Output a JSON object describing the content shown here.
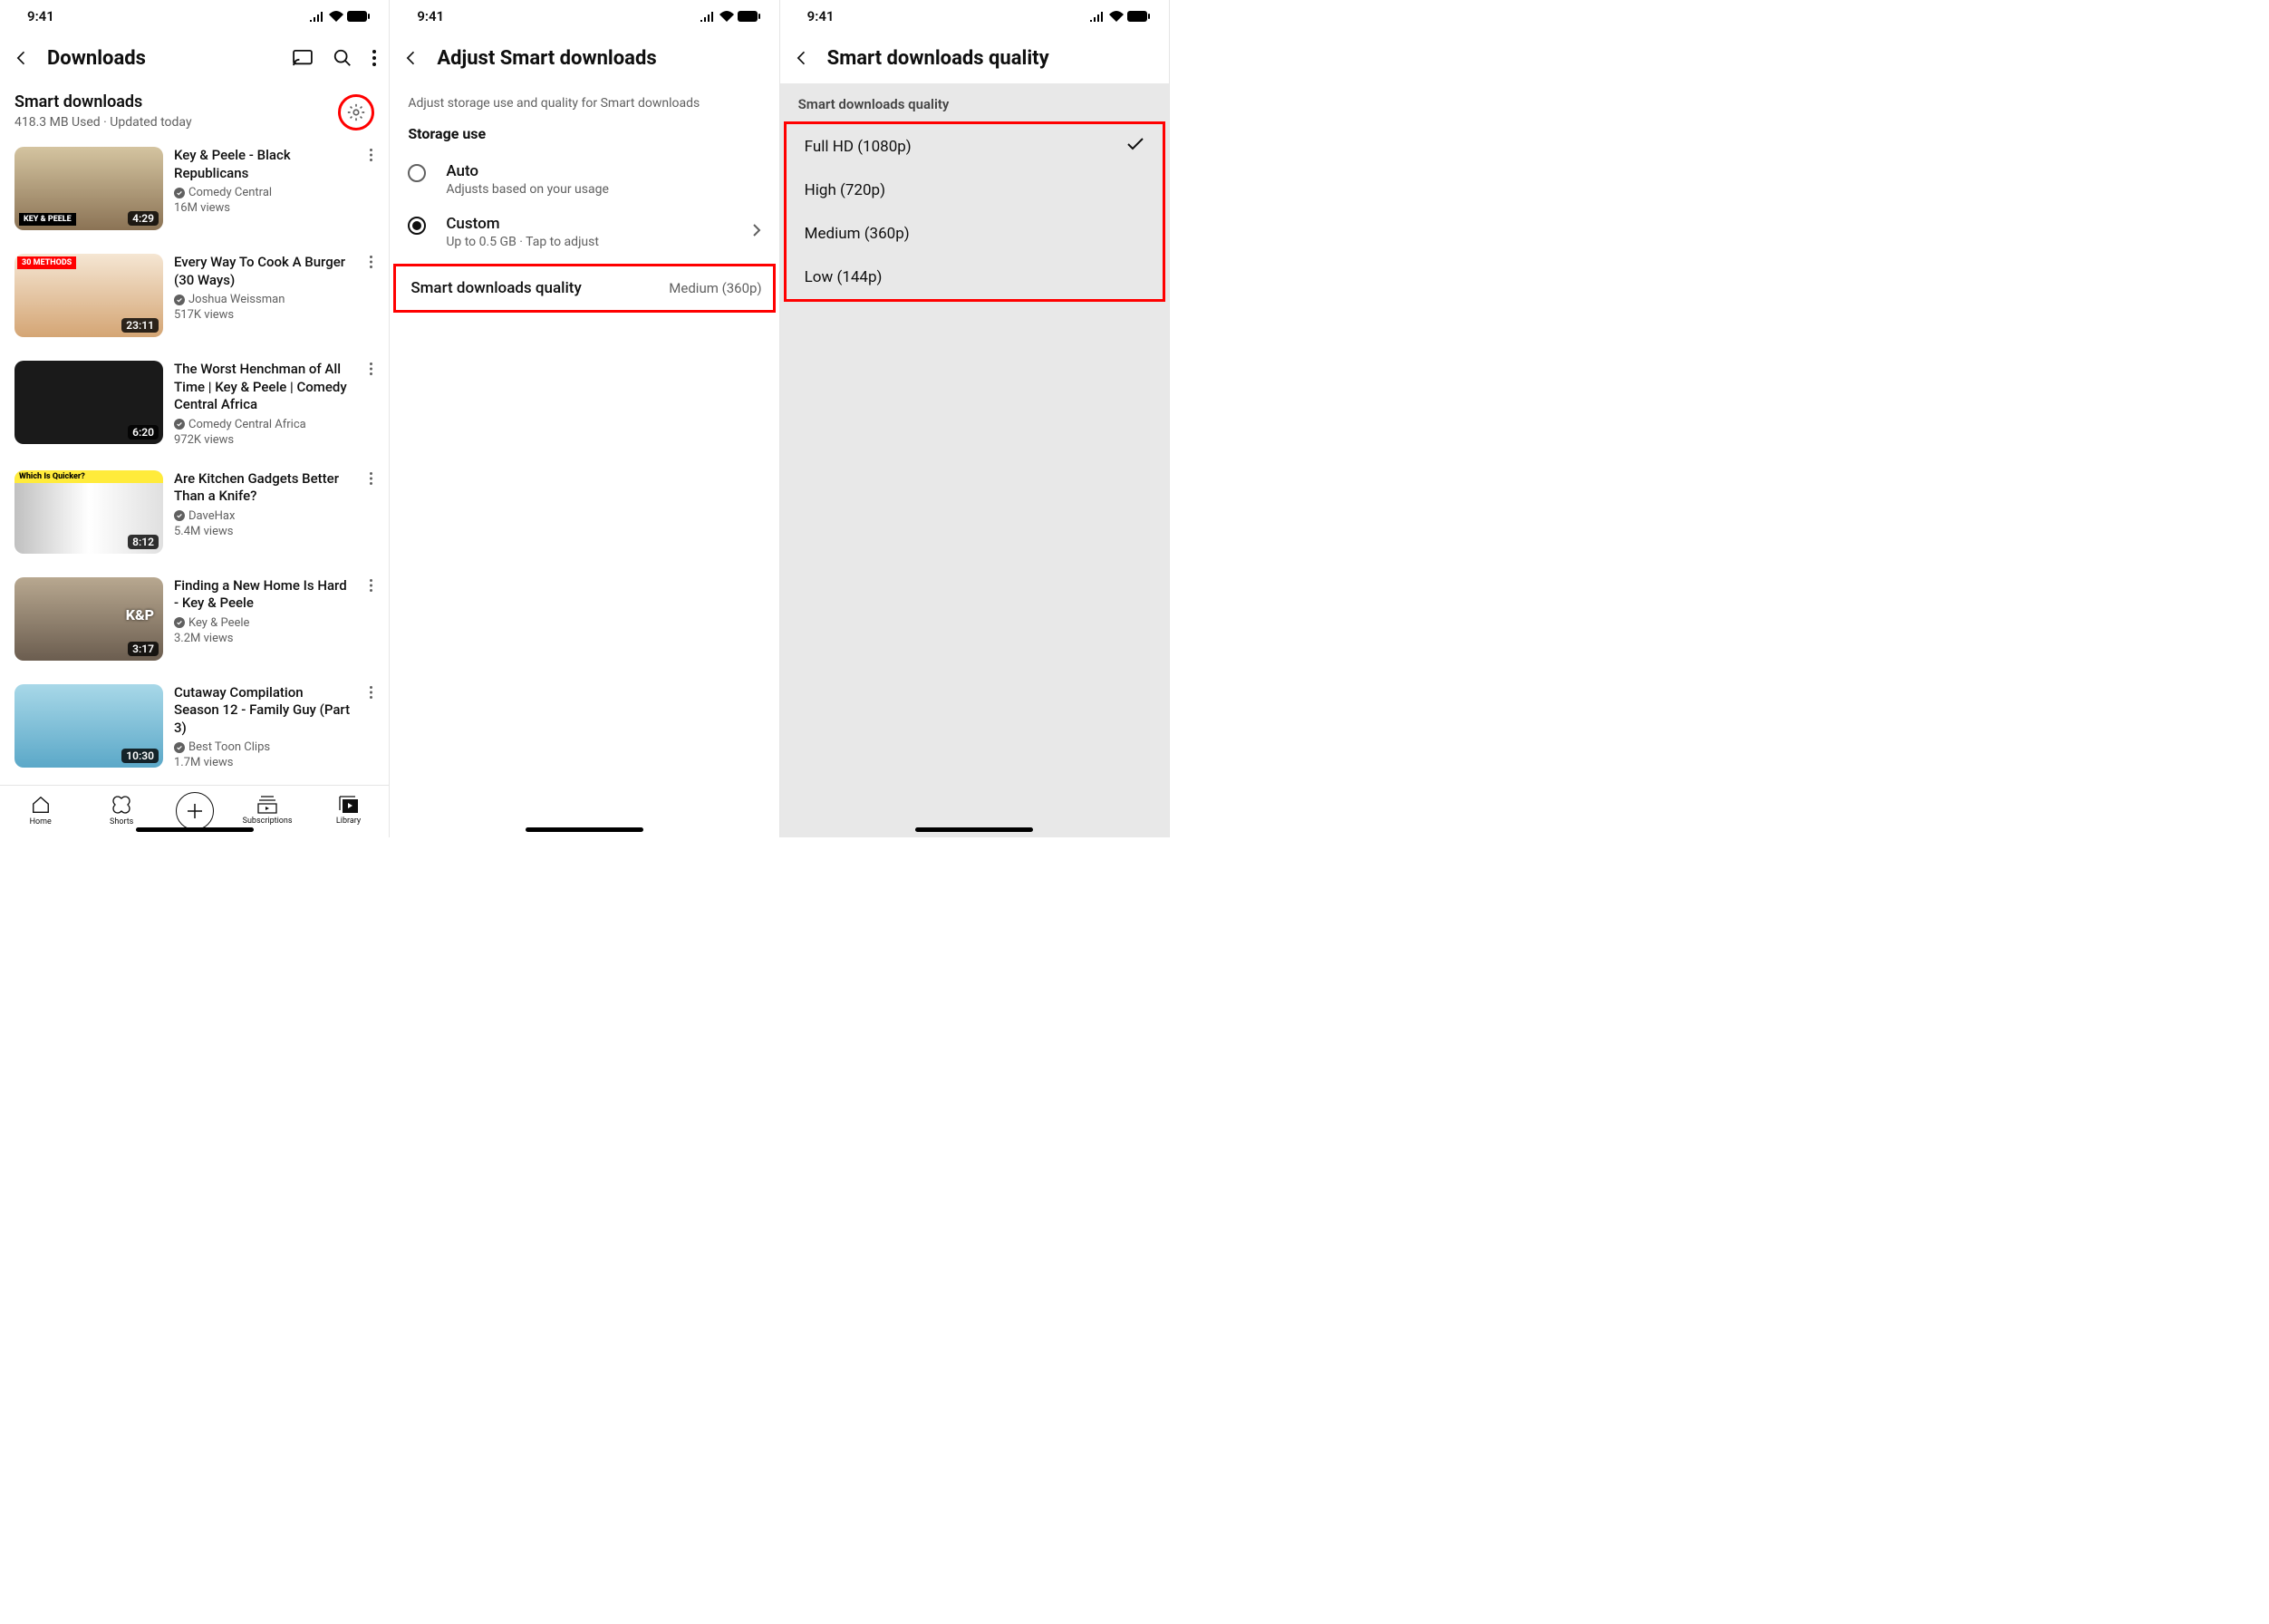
{
  "status": {
    "time": "9:41"
  },
  "p1": {
    "header": {
      "title": "Downloads"
    },
    "smart": {
      "title": "Smart downloads",
      "sub": "418.3 MB Used · Updated today"
    },
    "videos": [
      {
        "title": "Key & Peele - Black Republicans",
        "channel": "Comedy Central",
        "views": "16M views",
        "duration": "4:29",
        "overlay": "KEY & PEELE"
      },
      {
        "title": "Every Way To Cook A Burger (30 Ways)",
        "channel": "Joshua Weissman",
        "views": "517K views",
        "duration": "23:11",
        "overlay": "30 METHODS"
      },
      {
        "title": "The Worst Henchman of All Time | Key & Peele | Comedy Central Africa",
        "channel": "Comedy Central Africa",
        "views": "972K views",
        "duration": "6:20",
        "overlay": ""
      },
      {
        "title": "Are Kitchen Gadgets Better Than a Knife?",
        "channel": "DaveHax",
        "views": "5.4M views",
        "duration": "8:12",
        "overlay": "Which Is Quicker?"
      },
      {
        "title": "Finding a New Home Is Hard - Key & Peele",
        "channel": "Key & Peele",
        "views": "3.2M views",
        "duration": "3:17",
        "overlay": "K&P"
      },
      {
        "title": "Cutaway Compilation Season 12 - Family Guy (Part 3)",
        "channel": "Best Toon Clips",
        "views": "1.7M views",
        "duration": "10:30",
        "overlay": ""
      }
    ],
    "nav": {
      "home": "Home",
      "shorts": "Shorts",
      "subs": "Subscriptions",
      "library": "Library"
    }
  },
  "p2": {
    "header": {
      "title": "Adjust Smart downloads"
    },
    "subtitle": "Adjust storage use and quality for Smart downloads",
    "section": "Storage use",
    "auto": {
      "label": "Auto",
      "sub": "Adjusts based on your usage"
    },
    "custom": {
      "label": "Custom",
      "sub": "Up to 0.5 GB · Tap to adjust"
    },
    "quality": {
      "label": "Smart downloads quality",
      "value": "Medium (360p)"
    }
  },
  "p3": {
    "header": {
      "title": "Smart downloads quality"
    },
    "list_header": "Smart downloads quality",
    "options": [
      {
        "label": "Full HD (1080p)",
        "checked": true
      },
      {
        "label": "High (720p)",
        "checked": false
      },
      {
        "label": "Medium (360p)",
        "checked": false
      },
      {
        "label": "Low (144p)",
        "checked": false
      }
    ]
  }
}
